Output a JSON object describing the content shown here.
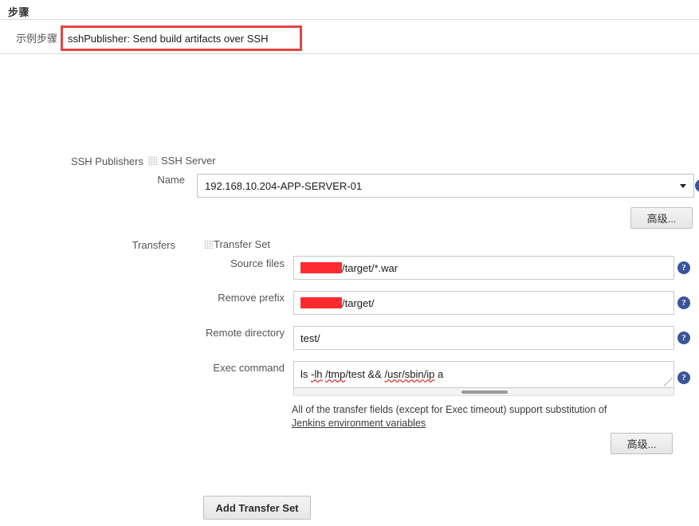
{
  "header": {
    "section_title": "步骤"
  },
  "sample_step": {
    "label": "示例步骤",
    "value": "sshPublisher: Send build artifacts over SSH",
    "highlight_color": "#e8433f"
  },
  "ssh_publishers": {
    "label": "SSH Publishers",
    "block_title": "SSH Server",
    "name": {
      "label": "Name",
      "value": "192.168.10.204-APP-SERVER-01"
    },
    "advanced_button": "高级..."
  },
  "transfers": {
    "label": "Transfers",
    "block_title": "Transfer Set",
    "fields": [
      {
        "label": "Source files",
        "redacted": true,
        "value": "/target/*.war"
      },
      {
        "label": "Remove prefix",
        "redacted": true,
        "value": "/target/"
      },
      {
        "label": "Remote directory",
        "redacted": false,
        "value": "test/"
      }
    ],
    "exec_command": {
      "label": "Exec command",
      "value": "ls -lh /tmp/test && /usr/sbin/ip a",
      "tokens": [
        {
          "text": "ls ",
          "misspelled": false
        },
        {
          "text": "-lh",
          "misspelled": true
        },
        {
          "text": " ",
          "misspelled": false
        },
        {
          "text": "/tmp",
          "misspelled": true
        },
        {
          "text": "/test && ",
          "misspelled": false
        },
        {
          "text": "/usr",
          "misspelled": true
        },
        {
          "text": "/sbin",
          "misspelled": true
        },
        {
          "text": "/ip",
          "misspelled": true
        },
        {
          "text": " a",
          "misspelled": false
        }
      ]
    },
    "hint": {
      "text_before": "All of the transfer fields (except for Exec timeout) support substitution of ",
      "link_text": "Jenkins environment variables"
    },
    "advanced_button": "高级...",
    "add_transfer_set_button": "Add Transfer Set"
  },
  "icons": {
    "help": "?",
    "help_icon_name": "help-icon",
    "help_color": "#39549b",
    "drag_grip": "drag-handle-icon"
  },
  "colors": {
    "redaction": "#fc2b30",
    "annotation_border": "#e8433f",
    "divider": "#d8d8d8"
  }
}
